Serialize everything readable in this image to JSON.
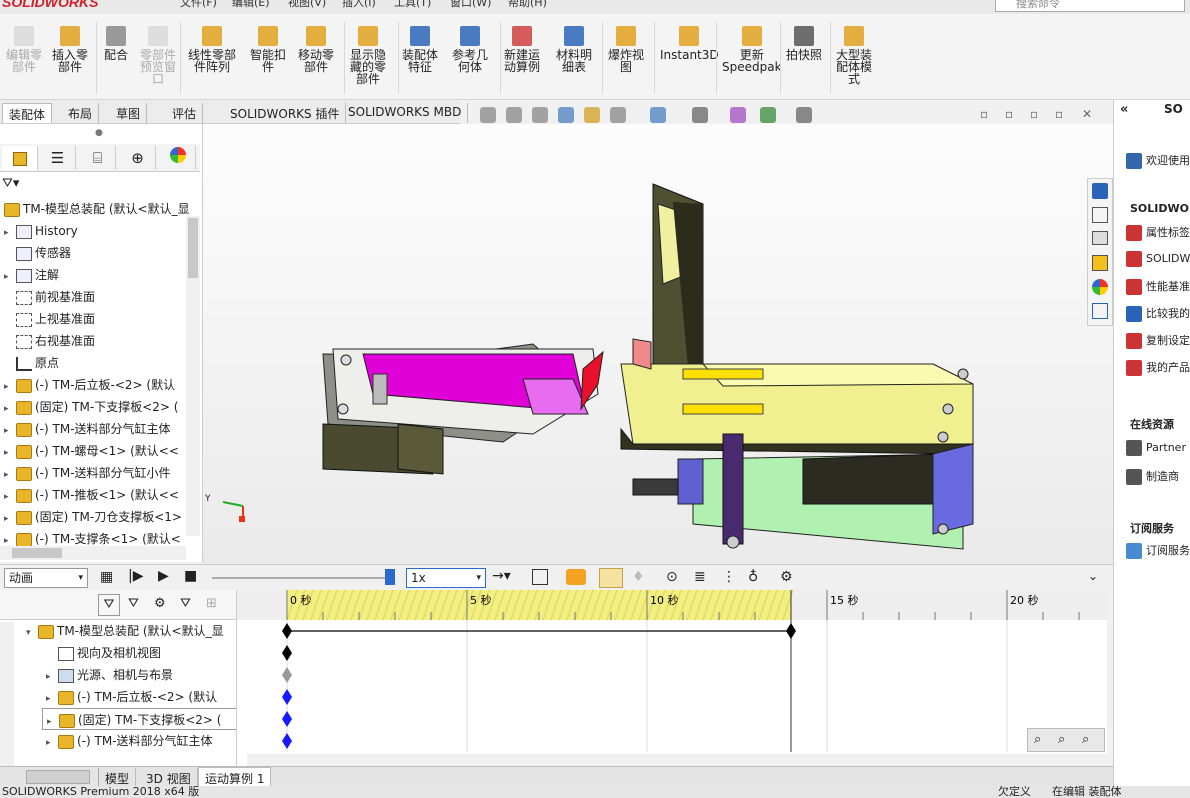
{
  "app": {
    "logo": "SOLIDWORKS",
    "menus": [
      "文件(F)",
      "编辑(E)",
      "视图(V)",
      "插入(I)",
      "工具(T)",
      "窗口(W)",
      "帮助(H)"
    ],
    "search_placeholder": "搜索命令"
  },
  "ribbon": [
    {
      "label": "编辑零\n部件",
      "dim": true
    },
    {
      "label": "插入零\n部件"
    },
    {
      "label": "配合"
    },
    {
      "label": "零部件\n预览窗\n口",
      "dim": true
    },
    {
      "label": "线性零部\n件阵列"
    },
    {
      "label": "智能扣\n件"
    },
    {
      "label": "移动零\n部件"
    },
    {
      "label": "显示隐\n藏的零\n部件"
    },
    {
      "label": "装配体\n特征"
    },
    {
      "label": "参考几\n何体"
    },
    {
      "label": "新建运\n动算例"
    },
    {
      "label": "材料明\n细表"
    },
    {
      "label": "爆炸视\n图"
    },
    {
      "label": "Instant3D"
    },
    {
      "label": "更新\nSpeedpak"
    },
    {
      "label": "拍快照"
    },
    {
      "label": "大型装\n配体模\n式"
    }
  ],
  "cmd_tabs": [
    "装配体",
    "布局",
    "草图",
    "评估",
    "SOLIDWORKS 插件",
    "SOLIDWORKS MBD"
  ],
  "tree": {
    "root": "TM-模型总装配 (默认<默认_显",
    "items": [
      {
        "label": "History",
        "icon": "history-icon",
        "tw": "▸"
      },
      {
        "label": "传感器",
        "icon": "sensor-icon",
        "tw": ""
      },
      {
        "label": "注解",
        "icon": "annotation-icon",
        "tw": "▸"
      },
      {
        "label": "前视基准面",
        "icon": "plane-icon",
        "tw": ""
      },
      {
        "label": "上视基准面",
        "icon": "plane-icon",
        "tw": ""
      },
      {
        "label": "右视基准面",
        "icon": "plane-icon",
        "tw": ""
      },
      {
        "label": "原点",
        "icon": "origin-icon",
        "tw": ""
      },
      {
        "label": "(-) TM-后立板-<2> (默认",
        "icon": "part-icon",
        "tw": "▸"
      },
      {
        "label": "(固定) TM-下支撑板<2> (",
        "icon": "part-icon",
        "tw": "▸"
      },
      {
        "label": "(-) TM-送料部分气缸主体",
        "icon": "part-icon",
        "tw": "▸"
      },
      {
        "label": "(-) TM-螺母<1> (默认<<",
        "icon": "part-icon",
        "tw": "▸"
      },
      {
        "label": "(-) TM-送料部分气缸小件",
        "icon": "part-icon",
        "tw": "▸"
      },
      {
        "label": "(-) TM-推板<1> (默认<<",
        "icon": "part-icon",
        "tw": "▸"
      },
      {
        "label": "(固定) TM-刀仓支撑板<1>",
        "icon": "part-icon",
        "tw": "▸"
      },
      {
        "label": "(-) TM-支撑条<1> (默认<",
        "icon": "part-icon",
        "tw": "▸"
      }
    ]
  },
  "taskpane": {
    "welcome": "欢迎使用",
    "section1": "SOLIDWORKS",
    "links1": [
      "属性标签",
      "SOLIDWORKS",
      "性能基准",
      "比较我的",
      "复制设定",
      "我的产品"
    ],
    "section2": "在线资源",
    "links2": [
      "Partner",
      "制造商"
    ],
    "section3": "订阅服务",
    "links3": [
      "订阅服务"
    ]
  },
  "motion": {
    "study_type": "动画",
    "speed": "1x",
    "tree": [
      {
        "label": "TM-模型总装配 (默认<默认_显",
        "tw": "▾"
      },
      {
        "label": "视向及相机视图",
        "tw": ""
      },
      {
        "label": "光源、相机与布景",
        "tw": "▸"
      },
      {
        "label": "(-) TM-后立板-<2> (默认",
        "tw": "▸"
      },
      {
        "label": "(固定) TM-下支撑板<2> (",
        "tw": "▸"
      },
      {
        "label": "(-) TM-送料部分气缸主体",
        "tw": "▸"
      }
    ],
    "ticks": [
      "0 秒",
      "5 秒",
      "10 秒",
      "15 秒",
      "20 秒"
    ]
  },
  "bottom_tabs": [
    "模型",
    "3D 视图",
    "运动算例 1"
  ],
  "status": {
    "left": "SOLIDWORKS Premium 2018 x64 版",
    "right": [
      "欠定义",
      "在编辑 装配体"
    ]
  }
}
